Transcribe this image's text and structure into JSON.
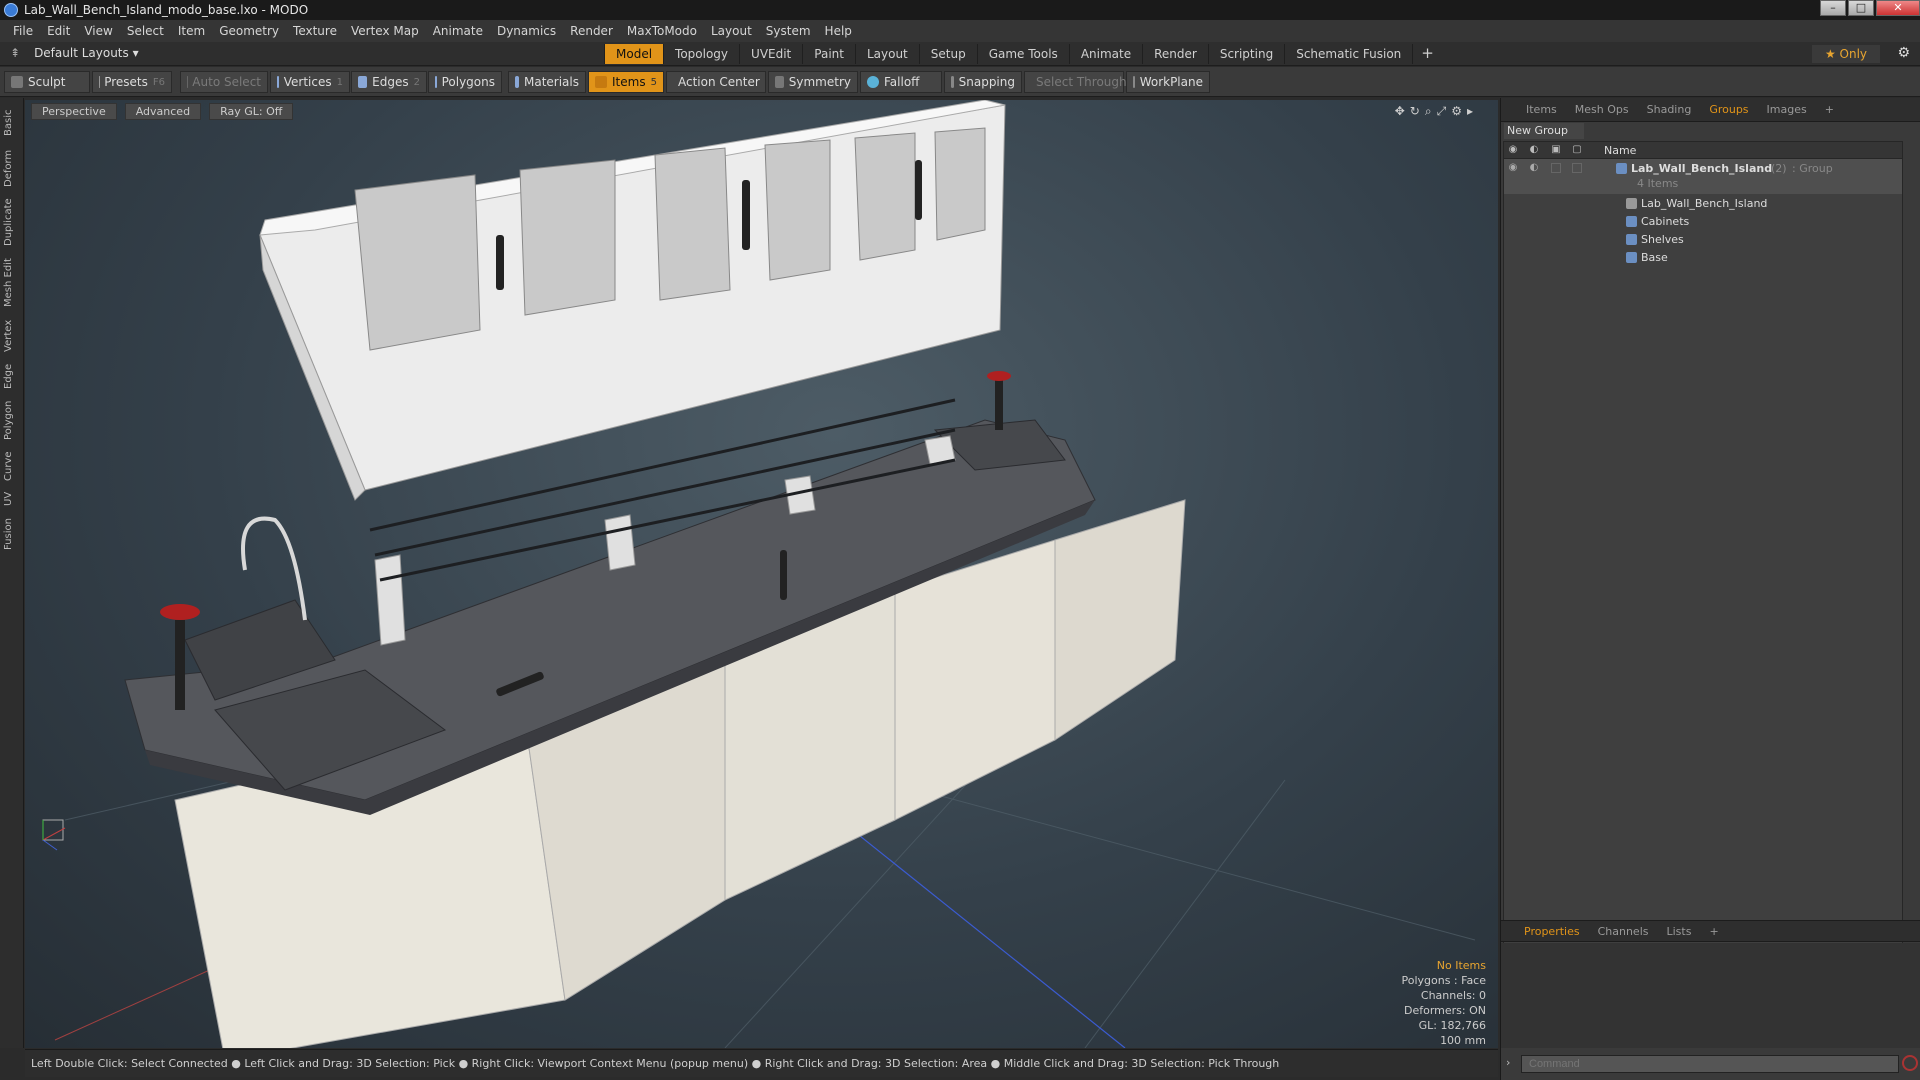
{
  "window": {
    "title": "Lab_Wall_Bench_Island_modo_base.lxo - MODO"
  },
  "menu": [
    "File",
    "Edit",
    "View",
    "Select",
    "Item",
    "Geometry",
    "Texture",
    "Vertex Map",
    "Animate",
    "Dynamics",
    "Render",
    "MaxToModo",
    "Layout",
    "System",
    "Help"
  ],
  "layouts": {
    "label": "Default Layouts"
  },
  "context_tabs": [
    "Model",
    "Topology",
    "UVEdit",
    "Paint",
    "Layout",
    "Setup",
    "Game Tools",
    "Animate",
    "Render",
    "Scripting",
    "Schematic Fusion"
  ],
  "context_tab_active": "Model",
  "only_button": "Only",
  "toolbar": {
    "sculpt": "Sculpt",
    "presets": "Presets",
    "presets_shortcut": "F6",
    "auto_select": "Auto Select",
    "vertices": "Vertices",
    "vertices_shortcut": "1",
    "edges": "Edges",
    "edges_shortcut": "2",
    "polygons": "Polygons",
    "materials": "Materials",
    "items": "Items",
    "items_shortcut": "5",
    "action_center": "Action Center",
    "symmetry": "Symmetry",
    "falloff": "Falloff",
    "snapping": "Snapping",
    "select_through": "Select Through",
    "workplane": "WorkPlane"
  },
  "left_tabs": [
    "Basic",
    "Deform",
    "Duplicate",
    "Mesh Edit",
    "Vertex",
    "Edge",
    "Polygon",
    "Curve",
    "UV",
    "Fusion"
  ],
  "viewport": {
    "perspective": "Perspective",
    "advanced": "Advanced",
    "raygl": "Ray GL: Off",
    "info": {
      "no_items": "No Items",
      "polygons": "Polygons : Face",
      "channels": "Channels: 0",
      "deformers": "Deformers: ON",
      "gl": "GL: 182,766",
      "scale": "100 mm"
    }
  },
  "status": "Left Double Click: Select Connected ● Left Click and Drag: 3D Selection: Pick ● Right Click: Viewport Context Menu (popup menu) ● Right Click and Drag: 3D Selection: Area ● Middle Click and Drag: 3D Selection: Pick Through",
  "panel_tabs": [
    "Items",
    "Mesh Ops",
    "Shading",
    "Groups",
    "Images"
  ],
  "panel_tab_active": "Groups",
  "new_group": "New Group",
  "tree": {
    "column_name": "Name",
    "group": {
      "name": "Lab_Wall_Bench_Island",
      "count": "(2)",
      "type": ": Group",
      "items": "4 Items"
    },
    "children": [
      "Lab_Wall_Bench_Island",
      "Cabinets",
      "Shelves",
      "Base"
    ]
  },
  "props_tabs": [
    "Properties",
    "Channels",
    "Lists"
  ],
  "props_tab_active": "Properties",
  "command_placeholder": "Command"
}
